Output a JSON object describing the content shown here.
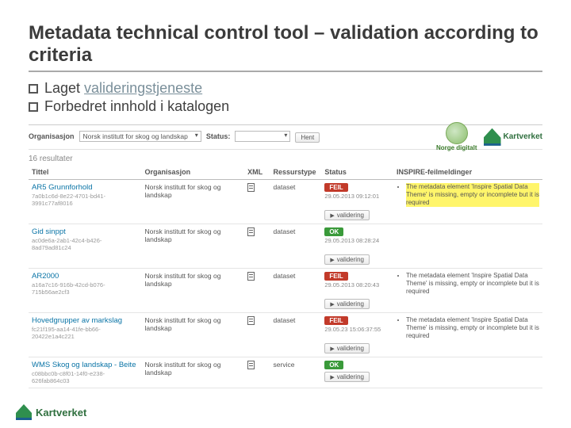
{
  "heading": "Metadata technical control tool – validation according to criteria",
  "bullets": {
    "b1_prefix": "Laget ",
    "b1_link": "valideringstjeneste",
    "b2": "Forbedret innhold i katalogen"
  },
  "filter": {
    "org_label": "Organisasjon",
    "org_value": "Norsk institutt for skog og landskap",
    "status_label": "Status:",
    "status_value": "",
    "button": "Hent"
  },
  "brand": {
    "norge": "Norge digitalt",
    "kartverket": "Kartverket"
  },
  "results_count": "16 resultater",
  "columns": {
    "title": "Tittel",
    "org": "Organisasjon",
    "xml": "XML",
    "res": "Ressurstype",
    "status": "Status",
    "msg": "INSPIRE-feilmeldinger"
  },
  "validate_btn": "validering",
  "rows": [
    {
      "title": "AR5 Grunnforhold",
      "guid": "7a0b1c6d-8e22-4701-bd41-3991c77af8016",
      "org": "Norsk institutt for skog og landskap",
      "res": "dataset",
      "status": "FEIL",
      "ts": "29.05.2013 09:12:01",
      "msg": "The metadata element 'Inspire Spatial Data Theme' is missing, empty or incomplete but it is required",
      "highlight": true
    },
    {
      "title": "Gid sinppt",
      "guid": "ac0de6a-2ab1-42c4-b426-8ad79ad81c24",
      "org": "Norsk institutt for skog og landskap",
      "res": "dataset",
      "status": "OK",
      "ts": "29.05.2013 08:28:24",
      "msg": "",
      "highlight": false
    },
    {
      "title": "AR2000",
      "guid": "a16a7c16-916b-42cd-b076-715b56ae2cf3",
      "org": "Norsk institutt for skog og landskap",
      "res": "dataset",
      "status": "FEIL",
      "ts": "29.05.2013 08:20:43",
      "msg": "The metadata element 'Inspire Spatial Data Theme' is missing, empty or incomplete but it is required",
      "highlight": false
    },
    {
      "title": "Hovedgrupper av markslag",
      "guid": "fc21f195-aa14-41fe-bb66-20422e1a4c221",
      "org": "Norsk institutt for skog og landskap",
      "res": "dataset",
      "status": "FEIL",
      "ts": "29.05.23 15:06:37:55",
      "msg": "The metadata element 'Inspire Spatial Data Theme' is missing, empty or incomplete but it is required",
      "highlight": false
    },
    {
      "title": "WMS Skog og landskap - Beite",
      "guid": "c08bbc0b-c8f01-14f0-e238-626fab864c03",
      "org": "Norsk institutt for skog og landskap",
      "res": "service",
      "status": "OK",
      "ts": "",
      "msg": "",
      "highlight": false
    }
  ]
}
